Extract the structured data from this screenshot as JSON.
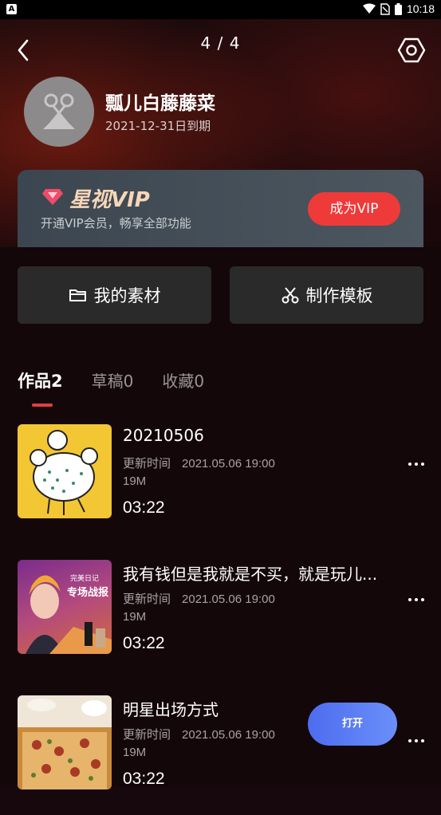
{
  "status_bar": {
    "time": "10:18"
  },
  "header": {
    "pager": "4 / 4"
  },
  "profile": {
    "name": "瓢儿白藤藤菜",
    "expiry": "2021-12-31日到期"
  },
  "vip": {
    "title": "星视VIP",
    "subtitle": "开通VIP会员，畅享全部功能",
    "button": "成为VIP"
  },
  "quick_actions": [
    {
      "label": "我的素材",
      "icon": "folder-icon"
    },
    {
      "label": "制作模板",
      "icon": "scissors-icon"
    }
  ],
  "tabs": [
    {
      "label": "作品2",
      "active": true
    },
    {
      "label": "草稿0",
      "active": false
    },
    {
      "label": "收藏0",
      "active": false
    }
  ],
  "works": [
    {
      "title": "20210506",
      "updated_label": "更新时间",
      "updated_time": "2021.05.06 19:00",
      "size": "19M",
      "duration": "03:22"
    },
    {
      "title": "我有钱但是我就是不买，就是玩儿...",
      "updated_label": "更新时间",
      "updated_time": "2021.05.06 19:00",
      "size": "19M",
      "duration": "03:22",
      "thumb_text_1": "完美日记",
      "thumb_text_2": "专场战报"
    },
    {
      "title": "明星出场方式",
      "updated_label": "更新时间",
      "updated_time": "2021.05.06 19:00",
      "size": "19M",
      "duration": "03:22"
    }
  ],
  "open_button": "打开",
  "colors": {
    "accent_red": "#ef3a3a",
    "open_blue": "#5a7df4",
    "vip_gold": "#f7d6b8"
  }
}
